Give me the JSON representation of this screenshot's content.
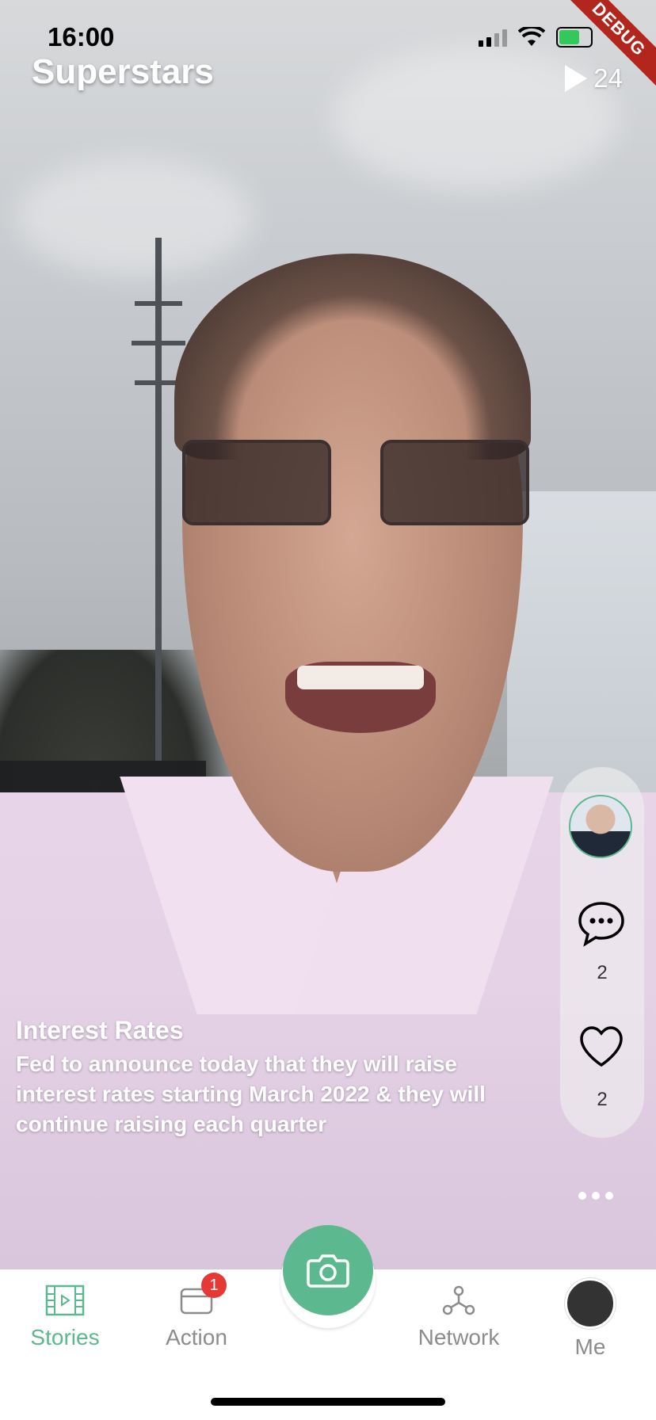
{
  "status_bar": {
    "time": "16:00",
    "debug_label": "DEBUG",
    "icons": [
      "signal-icon",
      "wifi-icon",
      "battery-charging-icon"
    ]
  },
  "header": {
    "title": "Superstars",
    "views_count": "24"
  },
  "story": {
    "title": "Interest Rates",
    "text": "Fed to announce today that they will raise interest rates starting March 2022 & they will continue raising each quarter"
  },
  "actions": {
    "comments_count": "2",
    "likes_count": "2"
  },
  "tabs": {
    "stories": "Stories",
    "action": "Action",
    "action_badge": "1",
    "network": "Network",
    "me": "Me"
  },
  "colors": {
    "accent": "#5cb88e",
    "badge": "#e53935",
    "inactive": "#8c8c8c"
  }
}
